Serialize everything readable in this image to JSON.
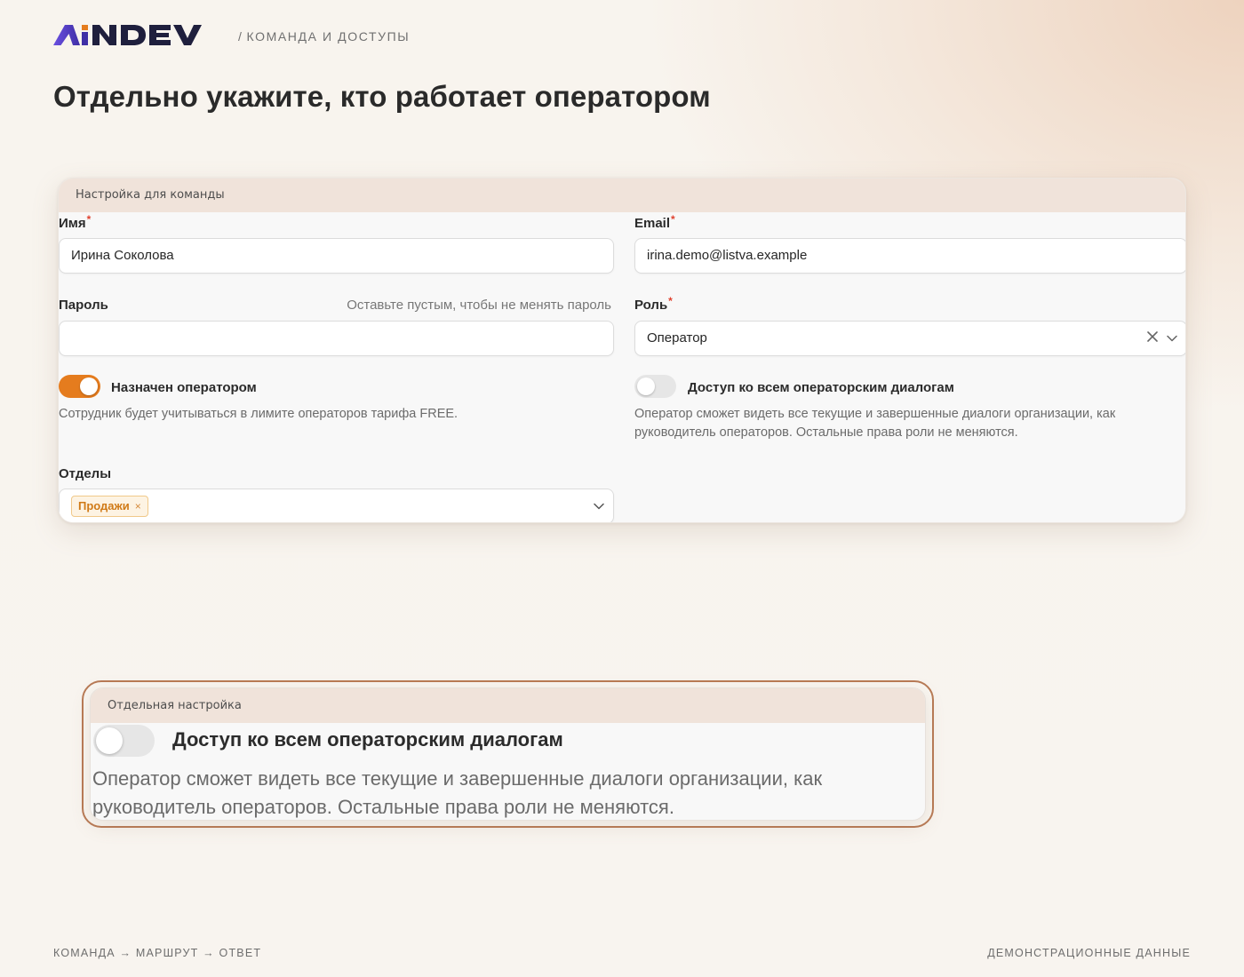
{
  "header": {
    "logo_text": "AiNDEV",
    "breadcrumb": "КОМАНДА И ДОСТУПЫ",
    "title": "Отдельно укажите, кто работает оператором"
  },
  "form": {
    "section_title": "Настройка для команды",
    "name_label": "Имя",
    "name_value": "Ирина Соколова",
    "email_label": "Email",
    "email_value": "irina.demo@listva.example",
    "password_label": "Пароль",
    "password_hint": "Оставьте пустым, чтобы не менять пароль",
    "password_value": "",
    "role_label": "Роль",
    "role_value": "Оператор",
    "required_mark": "*",
    "operator_toggle": {
      "label": "Назначен оператором",
      "on": true,
      "description": "Сотрудник будет учитываться в лимите операторов тарифа FREE."
    },
    "dialogs_toggle": {
      "label": "Доступ ко всем операторским диалогам",
      "on": false,
      "description_line1": "Оператор сможет видеть все текущие и завершенные диалоги организации, как",
      "description_line2": "руководитель операторов. Остальные права роли не меняются."
    },
    "departments_label": "Отделы",
    "departments": [
      {
        "label": "Продажи",
        "remove": "×"
      }
    ]
  },
  "zoom": {
    "section_title": "Отдельная настройка",
    "label": "Доступ ко всем операторским диалогам",
    "description_line1": "Оператор сможет видеть все текущие и завершенные диалоги организации, как",
    "description_line2": "руководитель операторов. Остальные права роли не меняются.",
    "on": false
  },
  "footer": {
    "left": "КОМАНДА → МАРШРУТ → ОТВЕТ",
    "right": "ДЕМОНСТРАЦИОННЫЕ ДАННЫЕ"
  },
  "colors": {
    "accent": "#e57c1e",
    "logo_blue": "#3f2fa6",
    "logo_dark": "#1f1f3d",
    "frame": "#b87a55"
  },
  "icons": {
    "clear": "close-icon",
    "dropdown": "chevron-down-icon"
  }
}
